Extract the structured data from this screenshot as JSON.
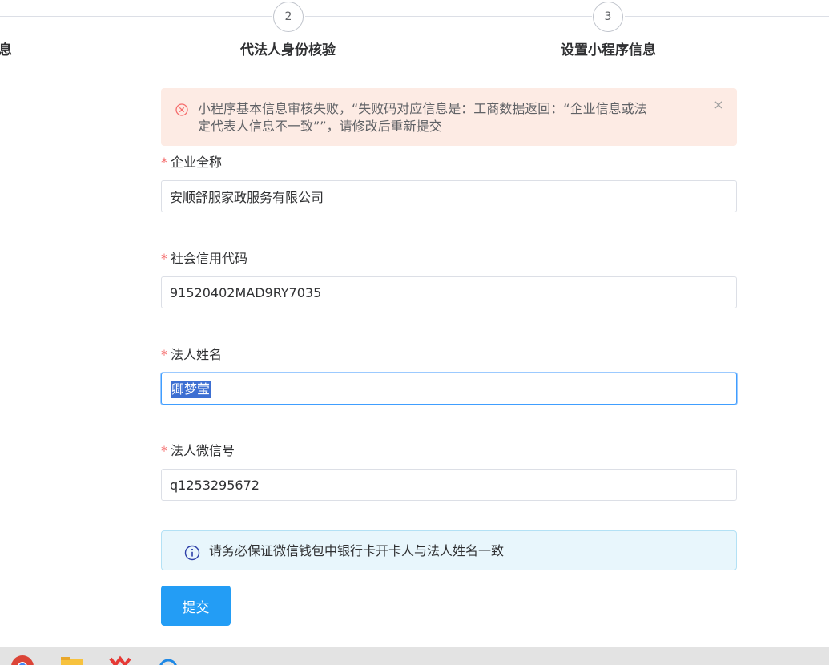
{
  "steps": {
    "step1": {
      "title_fragment": "息"
    },
    "step2": {
      "number": "2",
      "title": "代法人身份核验"
    },
    "step3": {
      "number": "3",
      "title": "设置小程序信息"
    }
  },
  "error_alert": {
    "icon": "circle-x-icon",
    "line1": "小程序基本信息审核失败，“失败码对应信息是：工商数据返回：“企业信息或法",
    "line2": "定代表人信息不一致””，请修改后重新提交",
    "close_icon": "close-icon",
    "color": "#fdebe4"
  },
  "form": {
    "company_name": {
      "required_mark": "*",
      "label": "企业全称",
      "value": "安顺舒服家政服务有限公司"
    },
    "credit_code": {
      "required_mark": "*",
      "label": "社会信用代码",
      "value": "91520402MAD9RY7035"
    },
    "legal_person": {
      "required_mark": "*",
      "label": "法人姓名",
      "value": "卿梦莹"
    },
    "wechat_id": {
      "required_mark": "*",
      "label": "法人微信号",
      "value": "q1253295672"
    }
  },
  "info_alert": {
    "icon": "info-circle-icon",
    "text": "请务必保证微信钱包中银行卡开卡人与法人姓名一致"
  },
  "submit_label": "提交",
  "colors": {
    "primary": "#239df5",
    "required": "#f56c6c",
    "selection": "#3d6fd2"
  },
  "taskbar": {
    "icons": [
      "chrome-icon",
      "folder-icon",
      "red-app-icon",
      "blue-circle-icon"
    ]
  }
}
